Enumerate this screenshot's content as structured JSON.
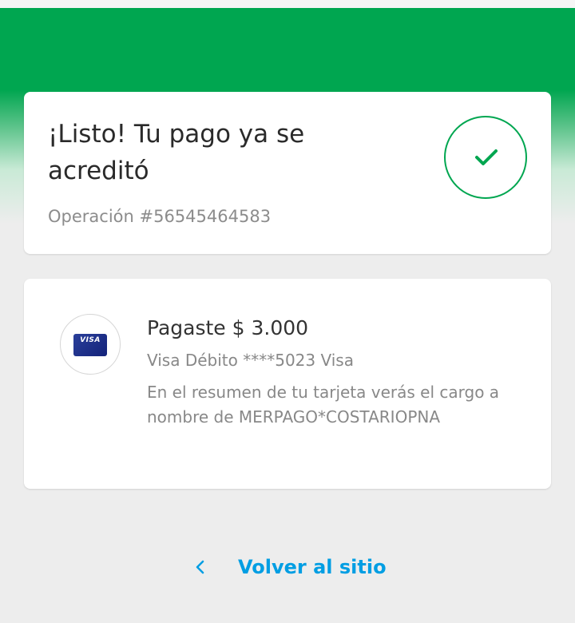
{
  "colors": {
    "brand_green": "#00a650",
    "link_blue": "#009ee3"
  },
  "status": {
    "title": "¡Listo! Tu pago ya se acreditó",
    "operation": "Operación #56545464583",
    "icon": "check-circle-icon"
  },
  "payment": {
    "card_brand_logo": "VISA",
    "amount": "Pagaste $ 3.000",
    "method": "Visa Débito ****5023 Visa",
    "statement_note": "En el resumen de tu tarjeta verás el cargo a nombre de MERPAGO*COSTARIOPNA"
  },
  "footer": {
    "back_label": "Volver al sitio",
    "back_icon": "chevron-left-icon"
  }
}
